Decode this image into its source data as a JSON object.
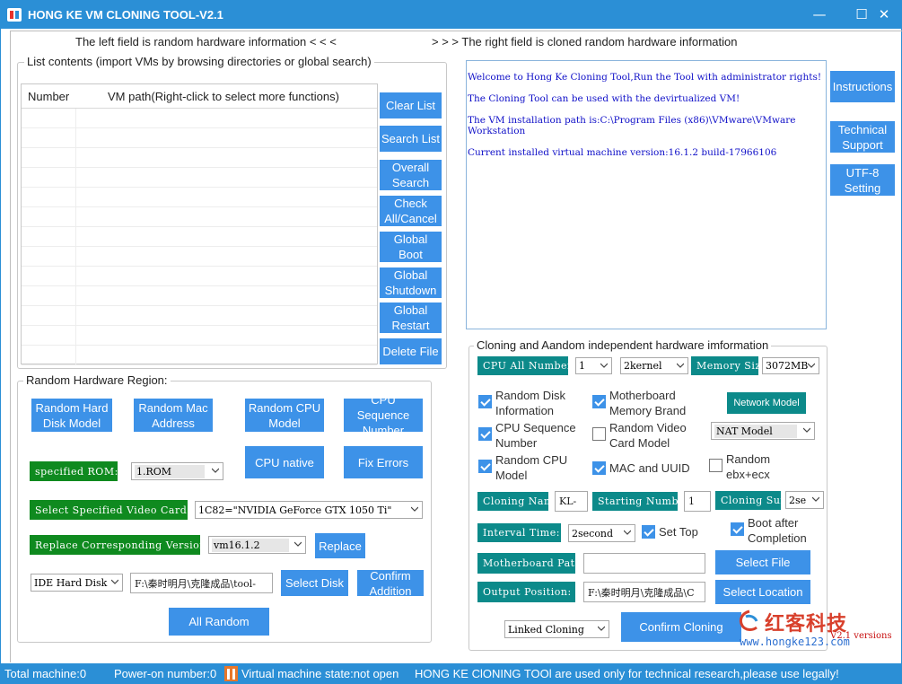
{
  "window": {
    "title": "HONG KE VM CLONING TOOL-V2.1",
    "controls": {
      "minimize": "—",
      "maximize": "☐",
      "close": "✕"
    }
  },
  "header": {
    "left_text": "The left field is random hardware information < < <",
    "right_text": "> > > The right field is cloned random hardware information"
  },
  "list_panel": {
    "label": "List contents (import VMs by browsing directories or global search)",
    "columns": [
      "Number",
      "VM path(Right-click to select more functions)"
    ],
    "rows": [],
    "buttons": {
      "clear": "Clear List",
      "search": "Search List",
      "overall": "Overall Search",
      "check": "Check All/Cancel",
      "boot": "Global Boot",
      "shutdown": "Global Shutdown",
      "restart": "Global Restart",
      "delete": "Delete File"
    }
  },
  "log": {
    "lines": [
      "Welcome to Hong Ke Cloning Tool,Run the Tool with administrator rights!",
      "The Cloning Tool can be used with the devirtualized VM!",
      "The VM installation path is:C:\\Program Files (x86)\\VMware\\VMware Workstation",
      "Current installed virtual machine version:16.1.2 build-17966106"
    ]
  },
  "side_buttons": {
    "instructions": "Instructions",
    "support": "Technical Support",
    "utf8": "UTF-8 Setting"
  },
  "random_region": {
    "label": "Random Hardware Region:",
    "buttons": {
      "hard_disk": "Random Hard Disk Model",
      "mac": "Random Mac Address",
      "cpu_model": "Random CPU Model",
      "cpu_seq": "CPU Sequence Number",
      "cpu_native": "CPU native",
      "fix_errors": "Fix Errors",
      "replace": "Replace",
      "select_disk": "Select Disk",
      "confirm_add": "Confirm Addition",
      "all_random": "All Random"
    },
    "rom_label": "specified ROM:",
    "rom_value": "1.ROM",
    "video_label": "Select Specified Video Card:",
    "video_value": "1C82=\"NVIDIA GeForce GTX 1050 Ti\"",
    "version_label": "Replace Corresponding Version:",
    "version_value": "vm16.1.2",
    "disk_type": "IDE Hard Disk",
    "disk_path": "F:\\秦时明月\\克隆成品\\tool-"
  },
  "clone_panel": {
    "label": "Cloning and Aandom independent hardware imformation",
    "cpu_all_label": "CPU All Number",
    "cpu_all_value": "1",
    "kernel_value": "2kernel",
    "memory_label": "Memory Size",
    "memory_value": "3072MB",
    "network_button": "Network Model",
    "network_value": "NAT Model",
    "checks": {
      "disk_info": {
        "label": "Random Disk Information",
        "checked": true
      },
      "mb_brand": {
        "label": "Motherboard Memory Brand",
        "checked": true
      },
      "cpu_seq": {
        "label": "CPU Sequence Number",
        "checked": true
      },
      "video_card": {
        "label": "Random Video Card Model",
        "checked": false
      },
      "cpu_model": {
        "label": "Random CPU Model",
        "checked": true
      },
      "mac_uuid": {
        "label": "MAC and UUID",
        "checked": true
      },
      "ebx_ecx": {
        "label": "Random ebx+ecx",
        "checked": false
      },
      "set_top": {
        "label": "Set Top",
        "checked": true
      },
      "boot_after": {
        "label": "Boot after Completion",
        "checked": true
      }
    },
    "cloning_name_label": "Cloning Name",
    "cloning_name_value": "KL-",
    "start_number_label": "Starting Number",
    "start_number_value": "1",
    "cloning_sum_label": "Cloning Sum",
    "cloning_sum_value": "2se",
    "interval_label": "Interval Time:",
    "interval_value": "2second",
    "mb_path_label": "Motherboard Path:",
    "mb_path_value": "",
    "select_file": "Select File",
    "output_label": "Output Position:",
    "output_value": "F:\\秦时明月\\克隆成品\\C",
    "select_location": "Select Location",
    "clone_mode": "Linked Cloning",
    "confirm_cloning": "Confirm Cloning"
  },
  "watermark": {
    "brand": "红客科技",
    "url": "www.hongke123.com",
    "version": "V2.1 versions"
  },
  "status": {
    "total": "Total machine:0",
    "power_on": "Power-on number:0",
    "state": "Virtual machine state:not open",
    "notice": "HONG KE ClONING TOOl are used only for technical research,please use legally!"
  },
  "colors": {
    "accent": "#2b8fd6",
    "button": "#3d92e8",
    "tag_green": "#0f8a1f",
    "tag_teal": "#0c8a8a",
    "log_text": "#1010c8"
  }
}
